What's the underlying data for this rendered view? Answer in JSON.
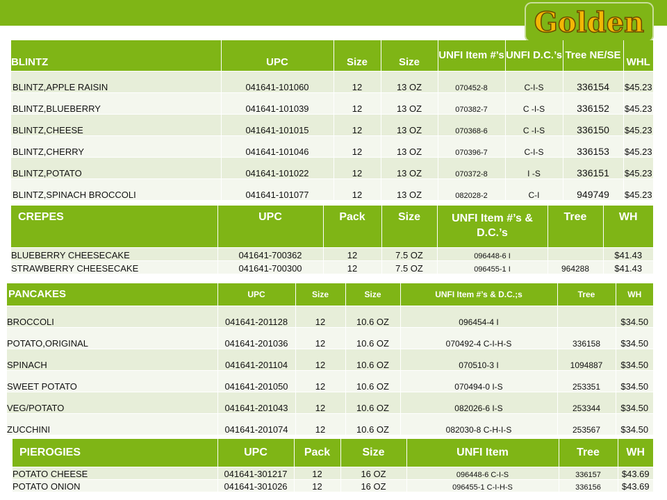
{
  "logo": {
    "text": "Golden"
  },
  "blintz": {
    "headers": [
      "BLINTZ",
      "UPC",
      "Size",
      "Size",
      "UNFI Item #’s",
      "UNFI D.C.’s",
      "Tree NE/SE",
      "WHL"
    ],
    "rows": [
      [
        "BLINTZ,APPLE RAISIN",
        "041641-101060",
        "12",
        "13 OZ",
        "070452-8",
        "C-I-S",
        "336154",
        "$45.23"
      ],
      [
        "BLINTZ,BLUEBERRY",
        "041641-101039",
        "12",
        "13 OZ",
        "070382-7",
        "C -I-S",
        "336152",
        "$45.23"
      ],
      [
        "BLINTZ,CHEESE",
        "041641-101015",
        "12",
        "13 OZ",
        "070368-6",
        "C -I-S",
        "336150",
        "$45.23"
      ],
      [
        "BLINTZ,CHERRY",
        "041641-101046",
        "12",
        "13 OZ",
        "070396-7",
        "C-I-S",
        "336153",
        "$45.23"
      ],
      [
        "BLINTZ,POTATO",
        "041641-101022",
        "12",
        "13 OZ",
        "070372-8",
        "I -S",
        "336151",
        "$45.23"
      ],
      [
        "BLINTZ,SPINACH BROCCOLI",
        "041641-101077",
        "12",
        "13 OZ",
        "082028-2",
        "C-I",
        "949749",
        "$45.23"
      ]
    ]
  },
  "crepes": {
    "headers": [
      "CREPES",
      "UPC",
      "Pack",
      "Size",
      "UNFI Item #’s & D.C.’s",
      "Tree",
      "WH"
    ],
    "rows": [
      [
        "BLUEBERRY  CHEESECAKE",
        "041641-700362",
        "12",
        "7.5 OZ",
        "096448-6   I",
        "",
        "$41.43"
      ],
      [
        "STRAWBERRY CHEESECAKE",
        "041641-700300",
        "12",
        "7.5 OZ",
        "096455-1   I",
        "964288",
        "$41.43"
      ]
    ]
  },
  "pancakes": {
    "headers": [
      "PANCAKES",
      "UPC",
      "Size",
      "Size",
      "UNFI Item #’s & D.C.;s",
      "Tree",
      "WH"
    ],
    "rows": [
      [
        "BROCCOLI",
        "041641-201128",
        "12",
        "10.6 OZ",
        "096454-4  I",
        "",
        "$34.50"
      ],
      [
        "POTATO,ORIGINAL",
        "041641-201036",
        "12",
        "10.6 OZ",
        "070492-4 C-I-H-S",
        "336158",
        "$34.50"
      ],
      [
        "SPINACH",
        "041641-201104",
        "12",
        "10.6 OZ",
        "070510-3   I",
        "1094887",
        "$34.50"
      ],
      [
        "SWEET POTATO",
        "041641-201050",
        "12",
        "10.6 OZ",
        "070494-0  I-S",
        "253351",
        "$34.50"
      ],
      [
        "VEG/POTATO",
        "041641-201043",
        "12",
        "10.6 OZ",
        "082026-6  I-S",
        "253344",
        "$34.50"
      ],
      [
        "ZUCCHINI",
        "041641-201074",
        "12",
        "10.6 OZ",
        "082030-8  C-H-I-S",
        "253567",
        "$34.50"
      ]
    ]
  },
  "pierogies": {
    "headers": [
      "PIEROGIES",
      "UPC",
      "Pack",
      "Size",
      "UNFI Item",
      "Tree",
      "WH"
    ],
    "rows": [
      [
        "POTATO CHEESE",
        "041641-301217",
        "12",
        "16 OZ",
        "096448-6   C-I-S",
        "336157",
        "$43.69"
      ],
      [
        "POTATO ONION",
        "041641-301026",
        "12",
        "16 OZ",
        "096455-1   C-I-H-S",
        "336156",
        "$43.69"
      ]
    ]
  }
}
